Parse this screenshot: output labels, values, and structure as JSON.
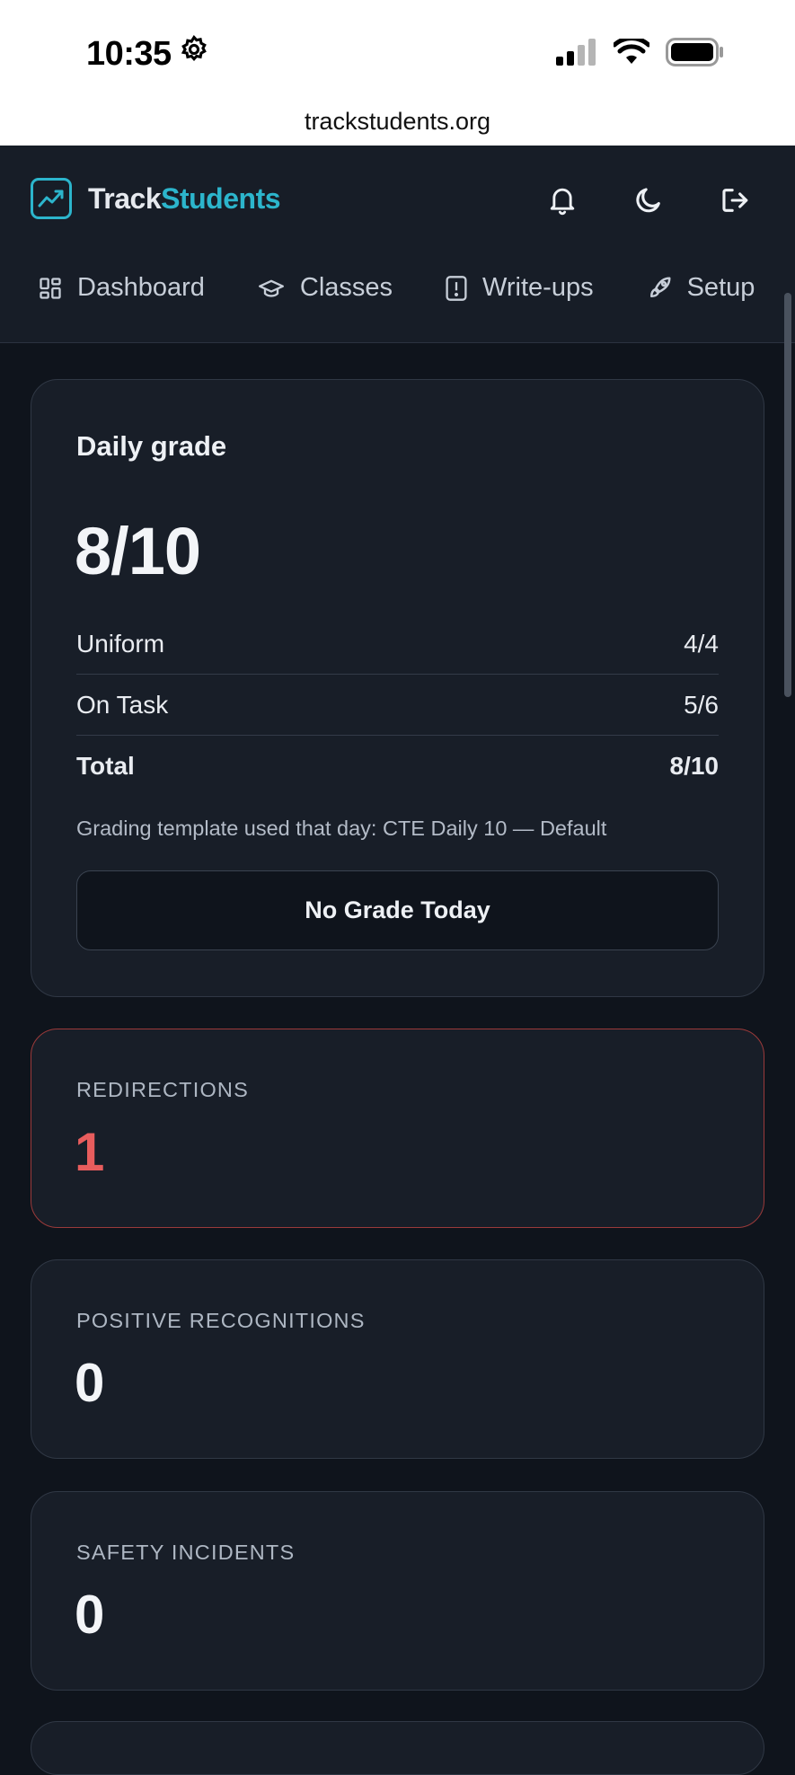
{
  "status_bar": {
    "time": "10:35",
    "url": "trackstudents.org"
  },
  "brand": {
    "name_part1": "Track",
    "name_part2": "Students",
    "accent_color": "#2cb5cc"
  },
  "header_icons": [
    "bell-icon",
    "moon-icon",
    "logout-icon"
  ],
  "nav": {
    "dashboard": "Dashboard",
    "classes": "Classes",
    "writeups": "Write-ups",
    "setup": "Setup"
  },
  "daily_grade": {
    "title": "Daily grade",
    "score": "8/10",
    "rows": [
      {
        "label": "Uniform",
        "value": "4/4"
      },
      {
        "label": "On Task",
        "value": "5/6"
      },
      {
        "label": "Total",
        "value": "8/10"
      }
    ],
    "template_note": "Grading template used that day: CTE Daily 10 — Default",
    "no_grade_button": "No Grade Today"
  },
  "stats": {
    "redirections": {
      "label": "REDIRECTIONS",
      "value": "1",
      "color": "#e85d5d"
    },
    "positive": {
      "label": "POSITIVE RECOGNITIONS",
      "value": "0"
    },
    "safety": {
      "label": "SAFETY INCIDENTS",
      "value": "0"
    }
  }
}
